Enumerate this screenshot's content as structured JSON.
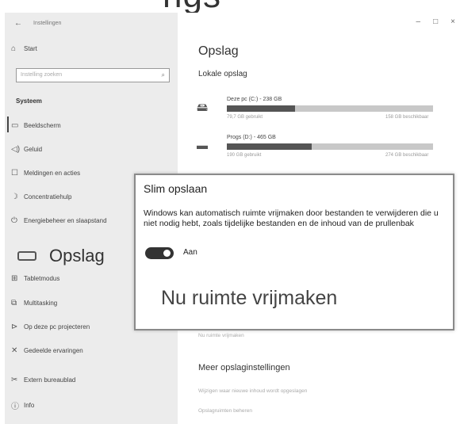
{
  "banner": {
    "text": "ngs"
  },
  "window": {
    "title": "Instellingen",
    "back_glyph": "←",
    "controls": {
      "minimize": "–",
      "maximize": "□",
      "close": "×"
    }
  },
  "sidebar": {
    "start": {
      "icon": "home-icon",
      "label": "Start"
    },
    "search_placeholder": "Instelling zoeken",
    "section": "Systeem",
    "items": [
      {
        "icon": "display-icon",
        "label": "Beeldscherm"
      },
      {
        "icon": "sound-icon",
        "label": "Geluid"
      },
      {
        "icon": "notifications-icon",
        "label": "Meldingen en acties"
      },
      {
        "icon": "moon-icon",
        "label": "Concentratiehulp"
      },
      {
        "icon": "power-icon",
        "label": "Energiebeheer en slaapstand"
      },
      {
        "icon": "storage-icon",
        "label": "Opslag"
      },
      {
        "icon": "tablet-icon",
        "label": "Tabletmodus"
      },
      {
        "icon": "multitask-icon",
        "label": "Multitasking"
      },
      {
        "icon": "project-icon",
        "label": "Op deze pc projecteren"
      },
      {
        "icon": "shared-icon",
        "label": "Gedeelde ervaringen"
      },
      {
        "icon": "remote-icon",
        "label": "Extern bureaublad"
      },
      {
        "icon": "info-icon",
        "label": "Info"
      }
    ]
  },
  "main": {
    "title": "Opslag",
    "local_storage": "Lokale opslag",
    "drives": [
      {
        "name": "Deze pc (C:) - 238 GB",
        "used": "79,7 GB gebruikt",
        "free": "158 GB beschikbaar",
        "fraction_used": 0.33
      },
      {
        "name": "Progs (D:) - 465 GB",
        "used": "190 GB gebruikt",
        "free": "274 GB beschikbaar",
        "fraction_used": 0.41
      }
    ],
    "lower_link_top": "Nu ruimte vrijmaken",
    "more_settings": "Meer opslaginstellingen",
    "links": [
      "Wijzigen waar nieuwe inhoud wordt opgeslagen",
      "Opslagruimten beheren"
    ]
  },
  "dialog": {
    "title": "Slim opslaan",
    "description": "Windows kan automatisch ruimte vrijmaken door bestanden te verwijderen die u niet nodig hebt, zoals tijdelijke bestanden en de inhoud van de prullenbak",
    "toggle_label": "Aan",
    "toggle_on": true,
    "free_now": "Nu ruimte vrijmaken"
  },
  "colors": {
    "sidebar_bg": "#ececec",
    "accent": "#333333",
    "bar_bg": "#c8c8c8"
  }
}
